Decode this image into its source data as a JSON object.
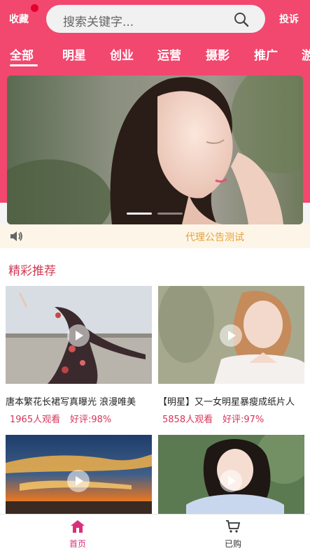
{
  "header": {
    "favorites_label": "收藏",
    "search_placeholder": "搜索关键字...",
    "complain_label": "投诉"
  },
  "tabs": [
    {
      "label": "全部",
      "active": true
    },
    {
      "label": "明星"
    },
    {
      "label": "创业"
    },
    {
      "label": "运营"
    },
    {
      "label": "摄影"
    },
    {
      "label": "推广"
    },
    {
      "label": "游"
    }
  ],
  "banner": {
    "slide_count": 2,
    "active_slide": 1
  },
  "notice": {
    "icon": "speaker-icon",
    "text": "代理公告测试"
  },
  "section": {
    "title": "精彩推荐"
  },
  "videos": [
    {
      "title": "唐本繁花长裙写真曝光 浪漫唯美",
      "views": "1965人观看",
      "rating": "好评:98%"
    },
    {
      "title": "【明星】又一女明星暴瘦成纸片人",
      "views": "5858人观看",
      "rating": "好评:97%"
    },
    {
      "title": "",
      "views": "",
      "rating": ""
    },
    {
      "title": "",
      "views": "",
      "rating": ""
    }
  ],
  "bottom_nav": [
    {
      "label": "首页",
      "icon": "home-icon",
      "active": true
    },
    {
      "label": "已购",
      "icon": "cart-icon",
      "active": false
    }
  ],
  "colors": {
    "brand": "#f2476e",
    "accent_text": "#d9345b",
    "notice_text": "#e6a23c"
  }
}
